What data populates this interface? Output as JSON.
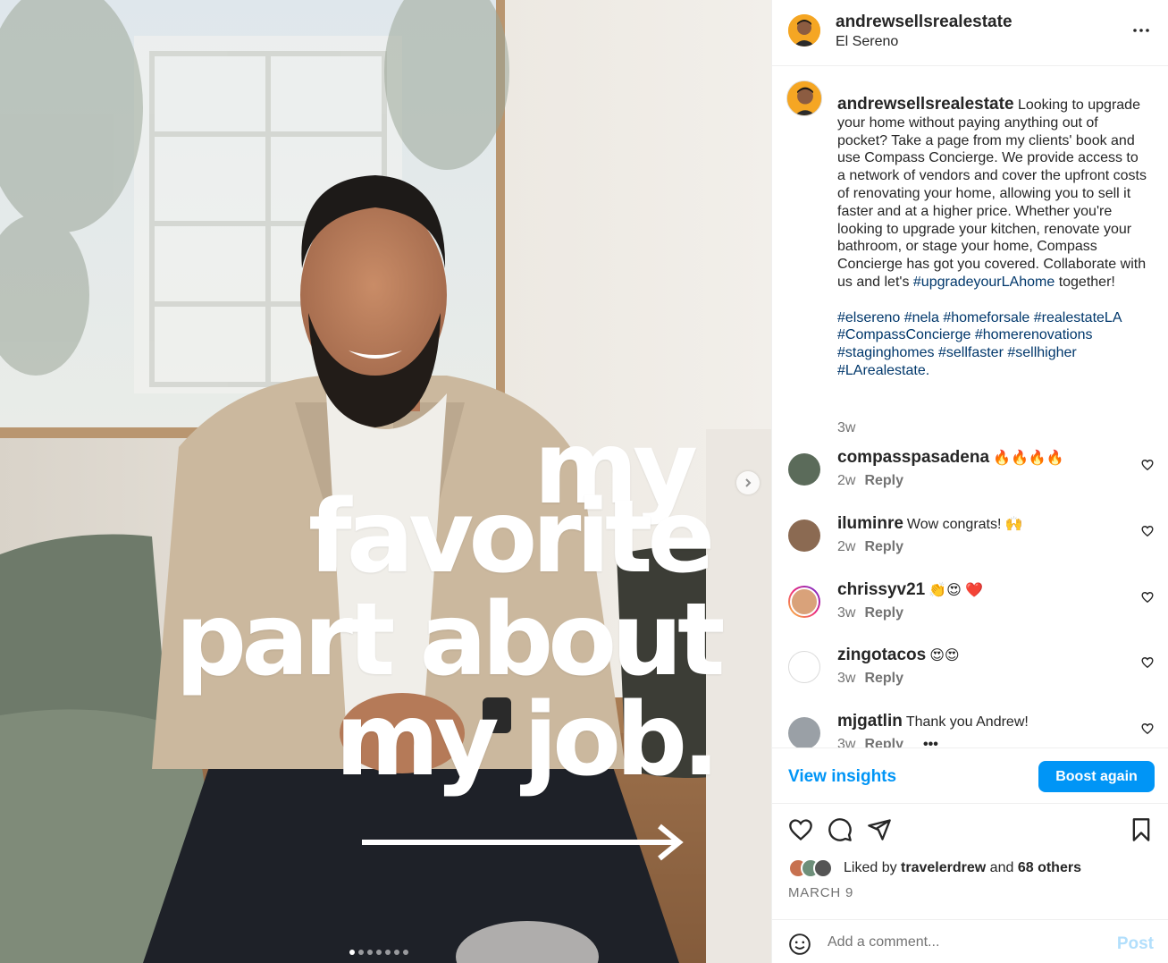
{
  "post": {
    "overlay_lines": [
      "my",
      "favorite",
      "part about",
      "my job."
    ],
    "carousel_count": 7,
    "carousel_active": 0
  },
  "header": {
    "username": "andrewsellsrealestate",
    "location": "El Sereno"
  },
  "caption": {
    "username": "andrewsellsrealestate",
    "text_before_tag": "Looking to upgrade your home without paying anything out of pocket? Take a page from my clients' book and use Compass Concierge. We provide access to a network of vendors and cover the upfront costs of renovating your home, allowing you to sell it faster and at a higher price. Whether you're looking to upgrade your kitchen, renovate your bathroom, or stage your home, Compass Concierge has got you covered. Collaborate with us and let's",
    "inline_tag": "#upgradeyourLAhome",
    "text_after_tag": "together!",
    "hashtags": [
      "#elsereno",
      "#nela",
      "#homeforsale",
      "#realestateLA",
      "#CompassConcierge",
      "#homerenovations",
      "#staginghomes",
      "#sellfaster",
      "#sellhigher",
      "#LArealestate."
    ],
    "age": "3w"
  },
  "comments": [
    {
      "username": "compasspasadena",
      "text": "🔥🔥🔥🔥",
      "age": "2w",
      "reply": "Reply"
    },
    {
      "username": "iluminre",
      "text": "Wow congrats! 🙌",
      "age": "2w",
      "reply": "Reply"
    },
    {
      "username": "chrissyv21",
      "text": "👏😍 ❤️",
      "age": "3w",
      "reply": "Reply"
    },
    {
      "username": "zingotacos",
      "text": "😍😍",
      "age": "3w",
      "reply": "Reply"
    },
    {
      "username": "mjgatlin",
      "text": "Thank you Andrew!",
      "age": "3w",
      "reply": "Reply"
    }
  ],
  "insights": {
    "link": "View insights",
    "boost": "Boost again"
  },
  "likes": {
    "prefix": "Liked by",
    "user": "travelerdrew",
    "and": "and",
    "others": "68 others"
  },
  "date": "MARCH 9",
  "add_comment": {
    "placeholder": "Add a comment...",
    "post_label": "Post"
  },
  "icons": {
    "like": "heart-icon",
    "comment": "comment-icon",
    "share": "share-icon",
    "save": "bookmark-icon",
    "emoji": "smile-icon",
    "more": "more-icon"
  },
  "colors": {
    "accent": "#0095f6",
    "link": "#00376b",
    "muted": "#737373",
    "post_disabled": "#b2dffc"
  }
}
